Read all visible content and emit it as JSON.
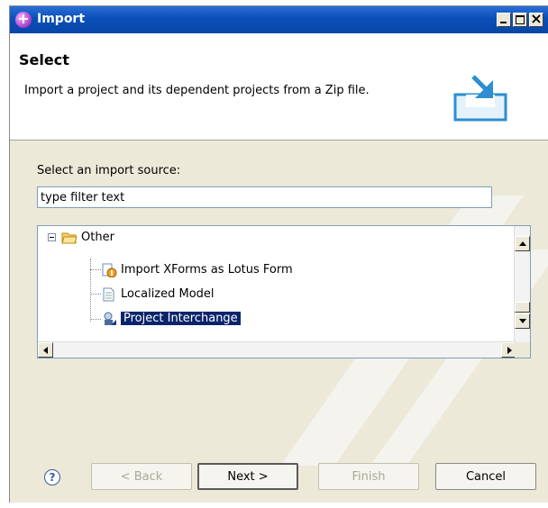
{
  "window": {
    "title": "Import"
  },
  "banner": {
    "title": "Select",
    "description": "Import a project and its dependent projects from a Zip file."
  },
  "source": {
    "label": "Select an import source:",
    "filter_value": "type filter text"
  },
  "tree": {
    "folder": "Other",
    "items": [
      {
        "label": "Import XForms as Lotus Form",
        "icon": "xforms-icon"
      },
      {
        "label": "Localized Model",
        "icon": "document-icon"
      },
      {
        "label": "Project Interchange",
        "icon": "project-interchange-icon",
        "selected": true
      }
    ]
  },
  "buttons": {
    "help": "?",
    "back": "< Back",
    "next": "Next >",
    "finish": "Finish",
    "cancel": "Cancel"
  },
  "colors": {
    "title_bar": "#0a4fb8",
    "selection": "#0a246a",
    "dialog_bg": "#ece9d8"
  }
}
